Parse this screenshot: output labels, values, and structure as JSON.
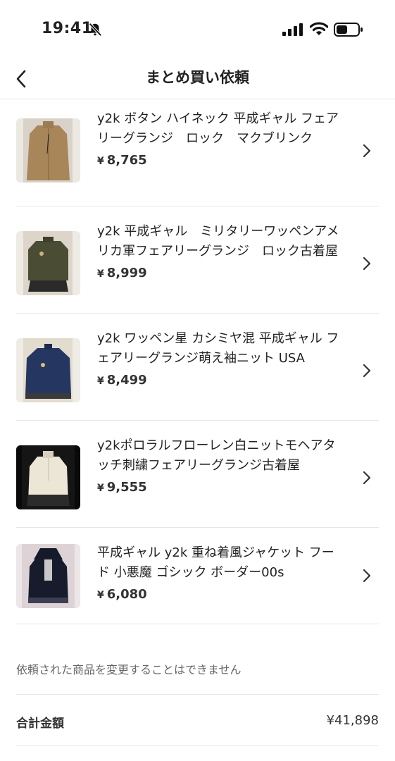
{
  "status_bar": {
    "time": "19:41"
  },
  "header": {
    "title": "まとめ買い依頼"
  },
  "items": [
    {
      "title": "y2k ボタン ハイネック 平成ギャル フェアリーグランジ　ロック　マクブリンク",
      "currency": "¥",
      "price": "8,765"
    },
    {
      "title": "y2k 平成ギャル　ミリタリーワッペンアメリカ軍フェアリーグランジ　ロック古着屋",
      "currency": "¥",
      "price": "8,999"
    },
    {
      "title": "y2k ワッペン星 カシミヤ混 平成ギャル フェアリーグランジ萌え袖ニット USA",
      "currency": "¥",
      "price": "8,499"
    },
    {
      "title": "y2kポロラルフローレン白ニットモヘアタッチ刺繍フェアリーグランジ古着屋",
      "currency": "¥",
      "price": "9,555"
    },
    {
      "title": "平成ギャル y2k 重ね着風ジャケット フード 小悪魔 ゴシック ボーダー00s",
      "currency": "¥",
      "price": "6,080"
    }
  ],
  "notice": "依頼された商品を変更することはできません",
  "total": {
    "label": "合計金額",
    "value": "¥41,898"
  },
  "icons": {
    "back": "chevron-left-icon",
    "row": "chevron-right-icon",
    "bell": "bell-slash-icon"
  }
}
